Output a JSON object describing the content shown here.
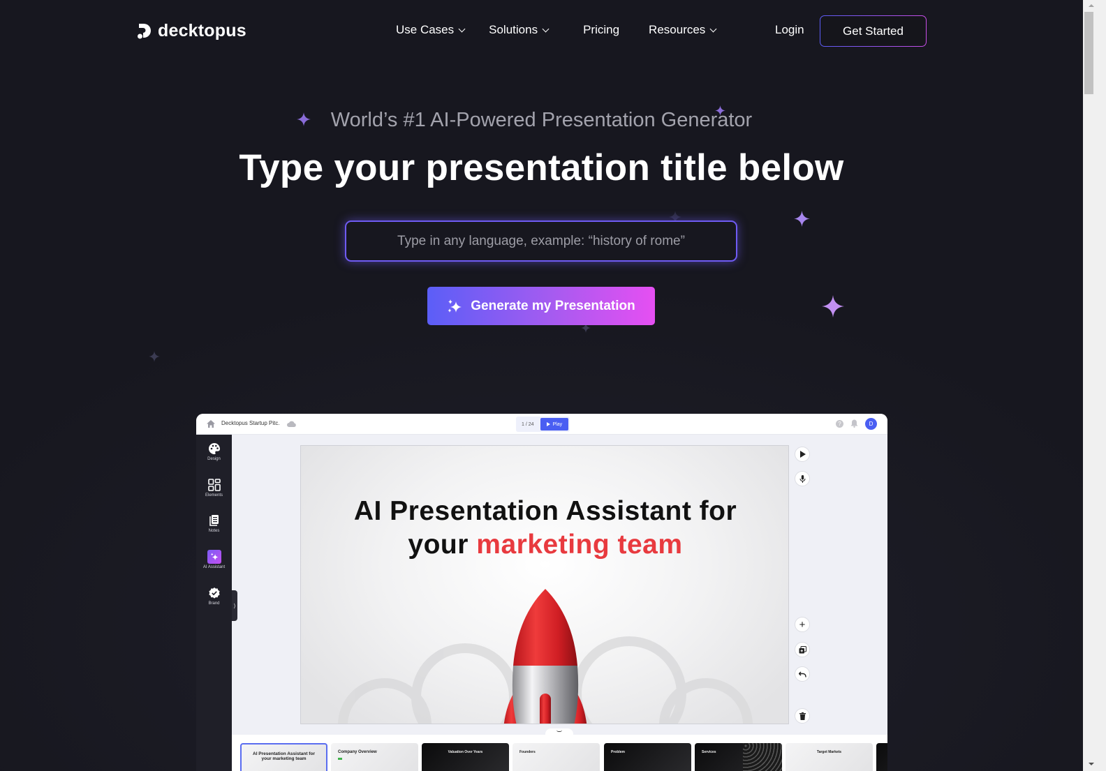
{
  "nav": {
    "logo_text": "decktopus",
    "links": [
      {
        "label": "Use Cases",
        "has_dropdown": true
      },
      {
        "label": "Solutions",
        "has_dropdown": true
      },
      {
        "label": "Pricing",
        "has_dropdown": false
      },
      {
        "label": "Resources",
        "has_dropdown": true
      }
    ],
    "login_label": "Login",
    "get_started_label": "Get Started"
  },
  "hero": {
    "subtitle": "World’s #1 AI-Powered Presentation Generator",
    "headline": "Type your presentation title below",
    "input_value": "",
    "input_placeholder": "Type in any language, example: “history of rome”",
    "generate_label": "Generate my Presentation"
  },
  "app_preview": {
    "doc_title": "Decktopus Startup Pitc.",
    "slide_counter": "1 / 24",
    "play_label": "Play",
    "help_icon": "?",
    "avatar_initial": "D",
    "sidebar": [
      {
        "label": "Design",
        "icon": "palette-icon"
      },
      {
        "label": "Elements",
        "icon": "grid-icon"
      },
      {
        "label": "Notes",
        "icon": "notes-icon"
      },
      {
        "label": "AI Assistant",
        "icon": "sparkle-icon"
      },
      {
        "label": "Brand",
        "icon": "badge-check-icon"
      }
    ],
    "slide": {
      "title_line1": "AI Presentation Assistant for",
      "title_line2_plain": "your ",
      "title_line2_accent": "marketing team"
    },
    "rail_buttons": [
      "play-icon",
      "mic-icon",
      "plus-icon",
      "duplicate-icon",
      "undo-icon",
      "trash-icon"
    ],
    "thumbnails": [
      {
        "title": "AI Presentation Assistant for your marketing team",
        "theme": "light",
        "active": true
      },
      {
        "title": "Company Overview",
        "theme": "light",
        "active": false
      },
      {
        "title": "Valuation Over Years",
        "theme": "dark",
        "active": false
      },
      {
        "title": "Founders",
        "theme": "light",
        "active": false
      },
      {
        "title": "Problem",
        "theme": "dark",
        "active": false
      },
      {
        "title": "Services",
        "theme": "dark",
        "active": false
      },
      {
        "title": "Target Markets",
        "theme": "light",
        "active": false
      },
      {
        "title": "",
        "theme": "dark",
        "active": false
      }
    ]
  },
  "colors": {
    "background": "#17171f",
    "accent_purple": "#6f5bf3",
    "gradient_start": "#5b5ef7",
    "gradient_end": "#e64ff2",
    "slide_accent_red": "#e83a3f",
    "app_blue": "#4a5ef2"
  }
}
